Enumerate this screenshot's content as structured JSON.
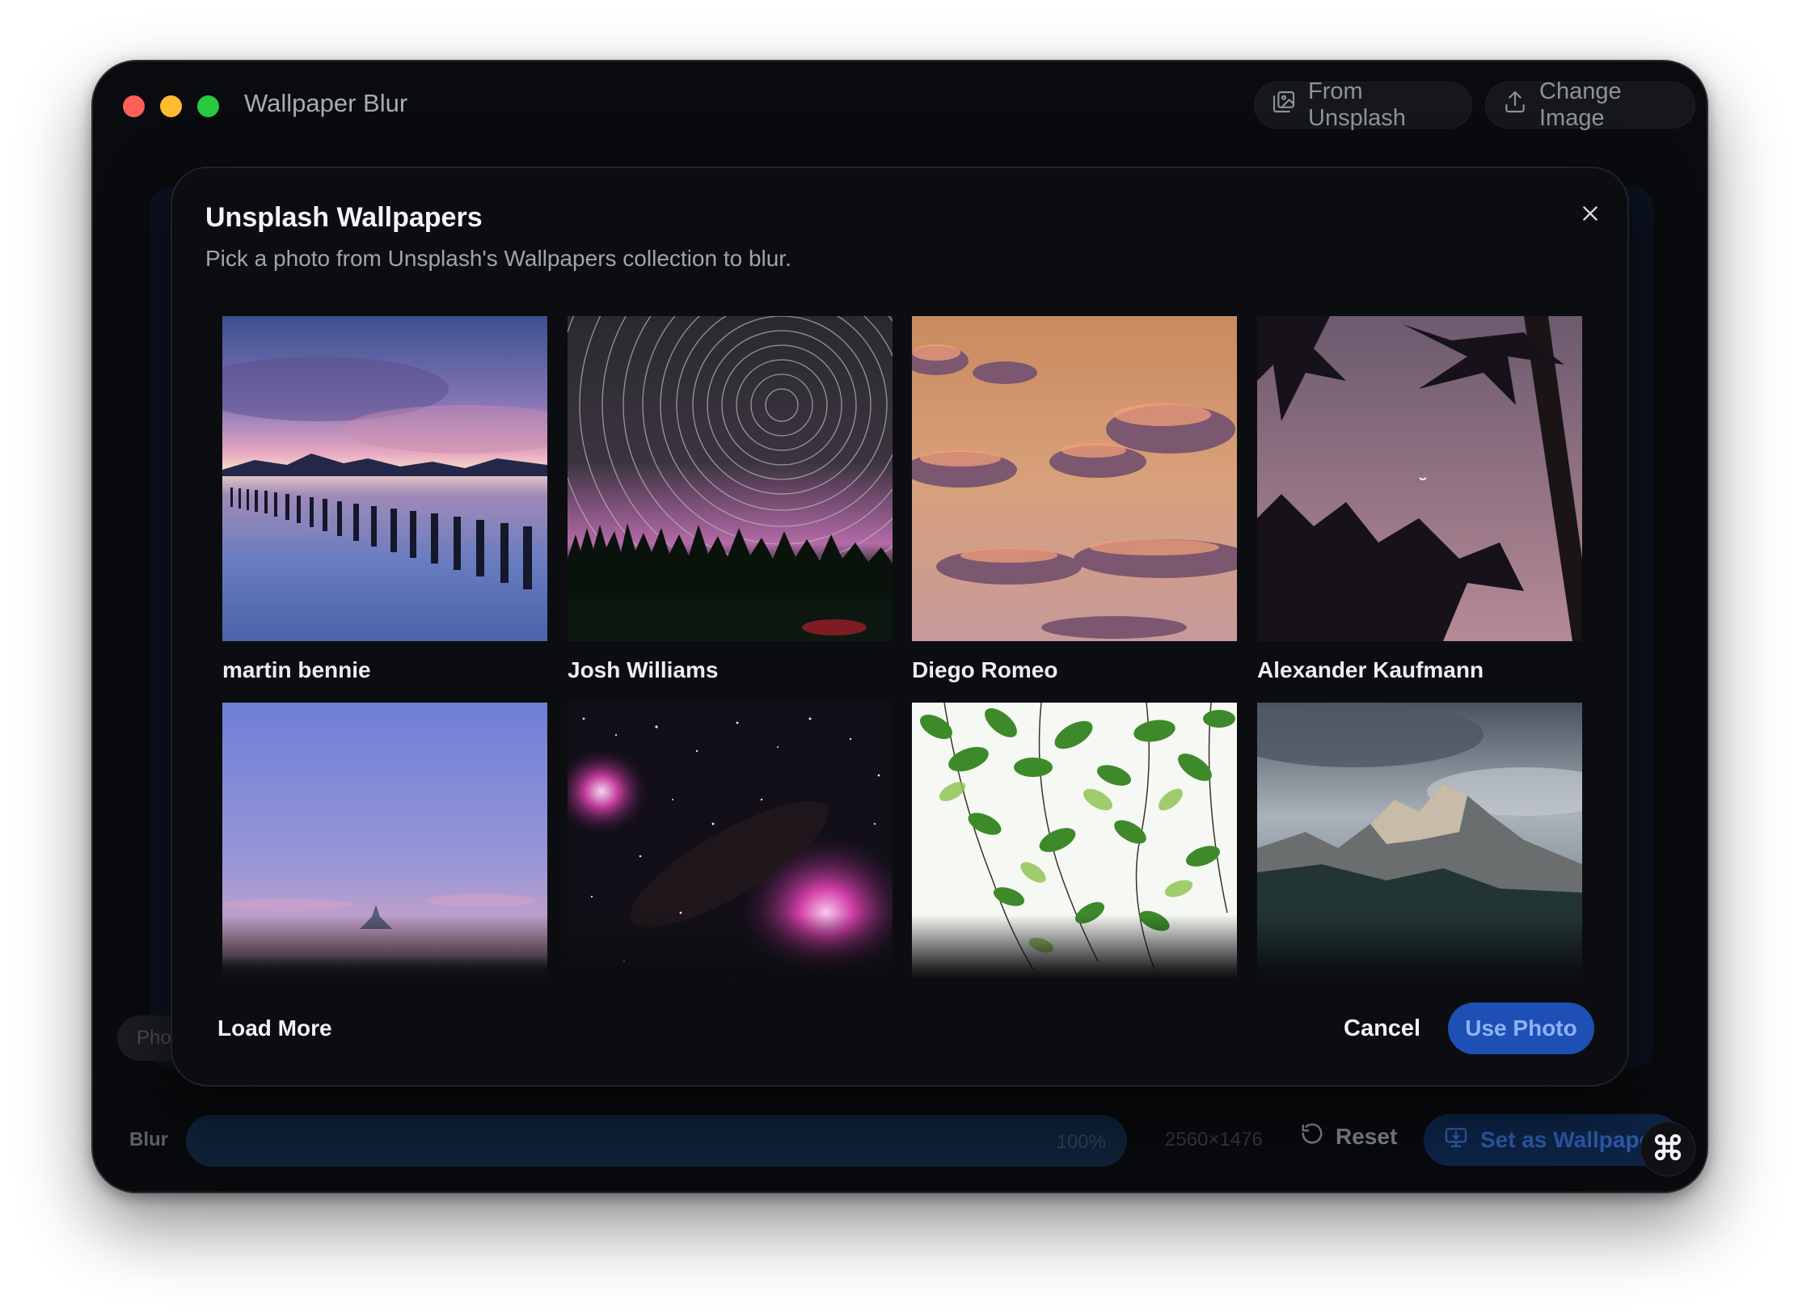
{
  "app": {
    "title": "Wallpaper Blur"
  },
  "toolbar": {
    "from_unsplash_label": "From Unsplash",
    "change_image_label": "Change Image"
  },
  "canvas": {
    "photo_chip_label": "Phot"
  },
  "bottom_bar": {
    "blur_label": "Blur",
    "blur_value": "100%",
    "blur_fraction": 1.0,
    "dimensions": "2560×1476",
    "reset_label": "Reset",
    "set_wallpaper_label": "Set as Wallpaper"
  },
  "modal": {
    "title": "Unsplash Wallpapers",
    "subtitle": "Pick a photo from Unsplash's Wallpapers collection to blur.",
    "photos": [
      {
        "photographer": "martin bennie",
        "subject": "lake sunset with wooden posts"
      },
      {
        "photographer": "Josh Williams",
        "subject": "star trails over forest"
      },
      {
        "photographer": "Diego Romeo",
        "subject": "pink clouds at sunset"
      },
      {
        "photographer": "Alexander Kaufmann",
        "subject": "palm silhouettes with moon"
      },
      {
        "photographer": "",
        "subject": "Mont Saint-Michel at dusk"
      },
      {
        "photographer": "",
        "subject": "nebula in starfield"
      },
      {
        "photographer": "",
        "subject": "green leaves on white"
      },
      {
        "photographer": "",
        "subject": "rocky mountains under clouds"
      }
    ],
    "load_more_label": "Load More",
    "cancel_label": "Cancel",
    "use_photo_label": "Use Photo"
  },
  "colors": {
    "accent": "#1e4fb4",
    "window_bg": "#0a0b0e",
    "modal_bg": "#0c0d10",
    "traffic_red": "#fe5f57",
    "traffic_yellow": "#febc2e",
    "traffic_green": "#28c840"
  },
  "icons": {
    "from_unsplash": "photo-stack-icon",
    "change_image": "upload-icon",
    "close": "close-icon",
    "reset": "reset-icon",
    "set_wallpaper": "monitor-icon",
    "fab": "command-icon"
  }
}
